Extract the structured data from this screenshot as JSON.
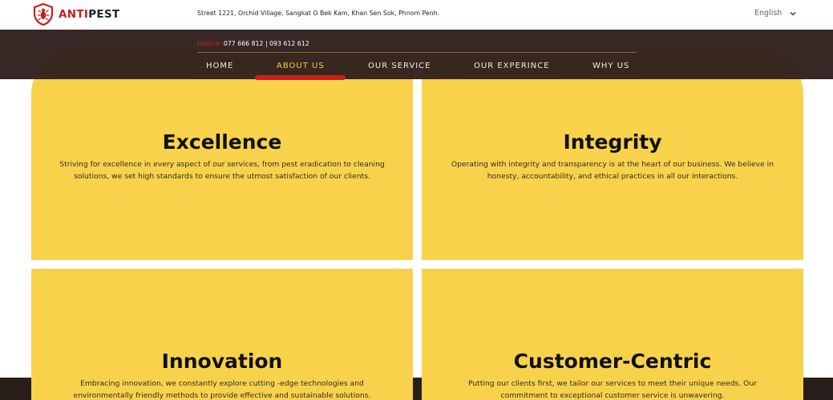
{
  "brand": {
    "anti": "ANTI",
    "pest": "PEST",
    "logo_icon": "bug-shield-icon",
    "accent": "#c8201c"
  },
  "topbar": {
    "address": "Street 1221, Orchid Village, Sangkat O Bek Kam, Khan Sen Sok, Phnom Penh.",
    "language": "English",
    "language_icon": "chevron-down-icon"
  },
  "header": {
    "hotline_label": "Hotline: ",
    "hotline_numbers": "077 666 812 | 093 612 612",
    "nav": [
      {
        "label": "HOME",
        "active": false
      },
      {
        "label": "ABOUT US",
        "active": true
      },
      {
        "label": "OUR SERVICE",
        "active": false
      },
      {
        "label": "OUR EXPERINCE",
        "active": false
      },
      {
        "label": "WHY US",
        "active": false
      }
    ],
    "active_color": "#f7c843",
    "background": "#301f1c"
  },
  "values": [
    {
      "title": "Excellence",
      "text": "Striving for excellence in every aspect of our services, from pest eradication to cleaning solutions, we set high standards to ensure the utmost satisfaction of our clients."
    },
    {
      "title": "Integrity",
      "text": "Operating with integrity and transparency is at the heart of our business. We believe in honesty, accountability, and ethical practices in all our interactions."
    },
    {
      "title": "Innovation",
      "text": "Embracing innovation, we constantly explore cutting -edge technologies and environmentally friendly methods to provide effective and sustainable solutions."
    },
    {
      "title": "Customer-Centric",
      "text": "Putting our clients first, we tailor our services to meet their unique needs. Our commitment to exceptional customer service is unwavering."
    }
  ],
  "card_color": "#f8d24a"
}
